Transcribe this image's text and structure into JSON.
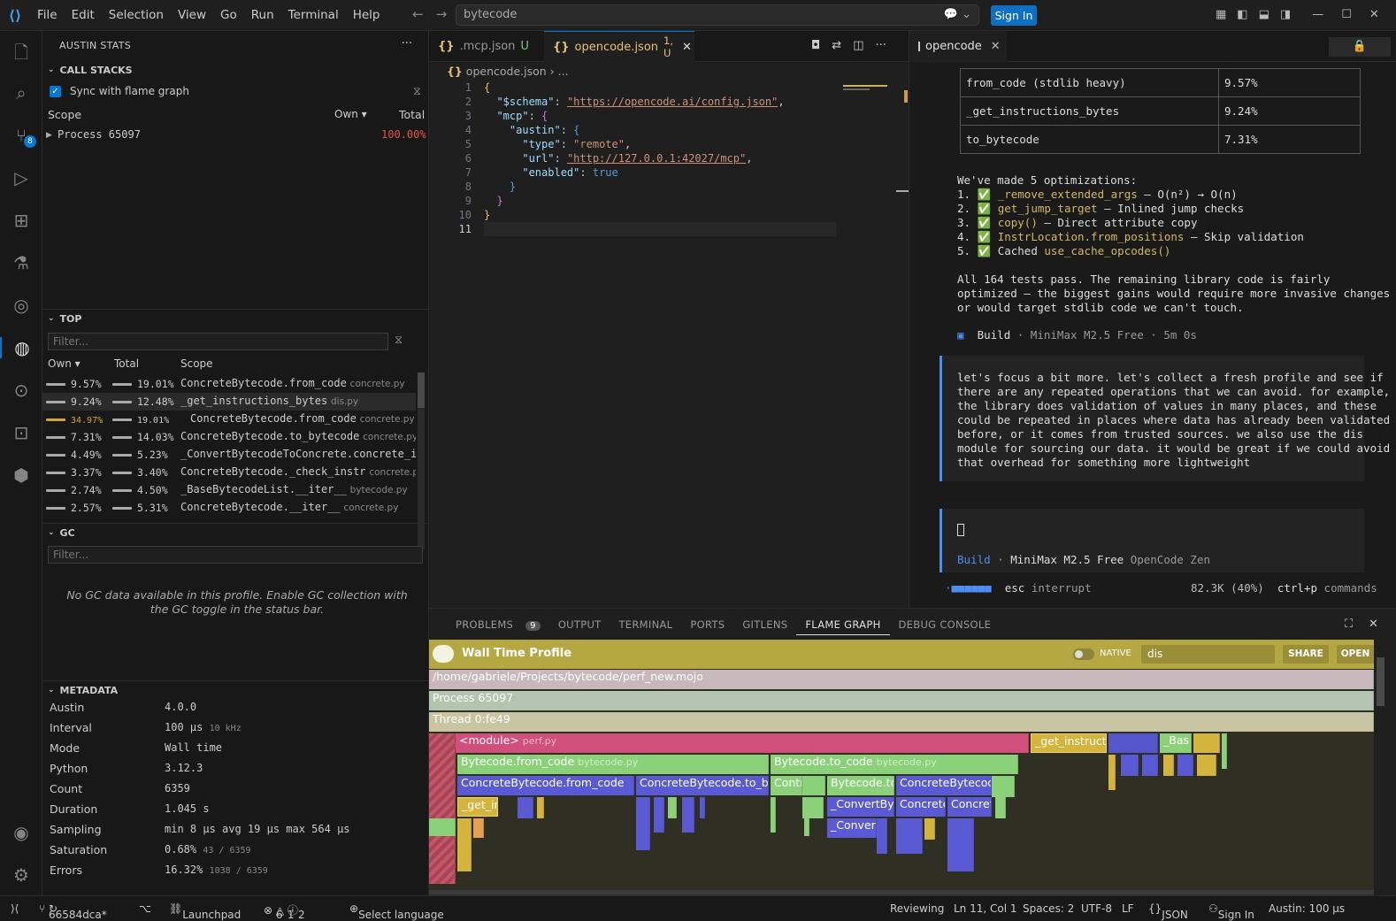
{
  "menu": [
    "File",
    "Edit",
    "Selection",
    "View",
    "Go",
    "Run",
    "Terminal",
    "Help"
  ],
  "search": {
    "value": "bytecode"
  },
  "signin_label": "Sign In",
  "activity": {
    "scm_badge": "8"
  },
  "sidebar": {
    "title": "AUSTIN STATS",
    "callstacks": {
      "header": "CALL STACKS",
      "sync_label": "Sync with flame graph",
      "cols": {
        "scope": "Scope",
        "own": "Own ▾",
        "total": "Total"
      },
      "process": "Process 65097",
      "process_total": "100.00%"
    },
    "top": {
      "header": "TOP",
      "filter_placeholder": "Filter...",
      "cols": {
        "own": "Own ▾",
        "total": "Total",
        "scope": "Scope"
      },
      "rows": [
        {
          "own": "9.57%",
          "total": "19.01%",
          "scope": "ConcreteBytecode.from_code",
          "file": "concrete.py"
        },
        {
          "own": "9.24%",
          "total": "12.48%",
          "scope": "_get_instructions_bytes",
          "file": "dis.py"
        },
        {
          "own": "34.97%",
          "total": "19.01%",
          "scope": "ConcreteBytecode.from_code",
          "file": "concrete.py"
        },
        {
          "own": "7.31%",
          "total": "14.03%",
          "scope": "ConcreteBytecode.to_bytecode",
          "file": "concrete.py"
        },
        {
          "own": "4.49%",
          "total": "5.23%",
          "scope": "_ConvertBytecodeToConcrete.concrete_inst",
          "file": ""
        },
        {
          "own": "3.37%",
          "total": "3.40%",
          "scope": "ConcreteBytecode._check_instr",
          "file": "concrete.py"
        },
        {
          "own": "2.74%",
          "total": "4.50%",
          "scope": "_BaseBytecodeList.__iter__",
          "file": "bytecode.py"
        },
        {
          "own": "2.57%",
          "total": "5.31%",
          "scope": "ConcreteBytecode.__iter__",
          "file": "concrete.py"
        }
      ]
    },
    "gc": {
      "header": "GC",
      "filter_placeholder": "Filter...",
      "empty": "No GC data available in this profile. Enable GC collection with the GC toggle in the status bar."
    },
    "metadata": {
      "header": "METADATA",
      "rows": [
        {
          "k": "Austin",
          "v": "4.0.0",
          "s": ""
        },
        {
          "k": "Interval",
          "v": "100 μs",
          "s": "10 kHz"
        },
        {
          "k": "Mode",
          "v": "Wall time",
          "s": ""
        },
        {
          "k": "Python",
          "v": "3.12.3",
          "s": ""
        },
        {
          "k": "Count",
          "v": "6359",
          "s": ""
        },
        {
          "k": "Duration",
          "v": "1.045 s",
          "s": ""
        },
        {
          "k": "Sampling",
          "v": "min 8 μs  avg 19 μs  max 564 μs",
          "s": ""
        },
        {
          "k": "Saturation",
          "v": "0.68%",
          "s": "43 / 6359"
        },
        {
          "k": "Errors",
          "v": "16.32%",
          "s": "1038 / 6359"
        }
      ]
    }
  },
  "editor": {
    "tabs": [
      {
        "label": ".mcp.json",
        "status": "U"
      },
      {
        "label": "opencode.json",
        "status": "1, U"
      }
    ],
    "breadcrumb": "opencode.json",
    "breadcrumb_more": "...",
    "lines": [
      "1",
      "2",
      "3",
      "4",
      "5",
      "6",
      "7",
      "8",
      "9",
      "10",
      "11"
    ],
    "code": {
      "schema_key": "\"$schema\"",
      "schema_val": "\"https://opencode.ai/config.json\"",
      "mcp_key": "\"mcp\"",
      "austin_key": "\"austin\"",
      "type_key": "\"type\"",
      "type_val": "\"remote\"",
      "url_key": "\"url\"",
      "url_val": "\"http://127.0.0.1:42027/mcp\"",
      "enabled_key": "\"enabled\"",
      "enabled_val": "true"
    }
  },
  "terminal": {
    "tab": "opencode",
    "table": [
      {
        "name": "from_code (stdlib heavy)",
        "pct": "9.57%"
      },
      {
        "name": "_get_instructions_bytes",
        "pct": "9.24%"
      },
      {
        "name": "to_bytecode",
        "pct": "7.31%"
      }
    ],
    "opt_header": "We've made 5 optimizations:",
    "opts": [
      {
        "n": "1.",
        "name": "_remove_extended_args",
        "desc": " – O(n²) → O(n)"
      },
      {
        "n": "2.",
        "name": "get_jump_target",
        "desc": " – Inlined jump checks"
      },
      {
        "n": "3.",
        "name": "copy()",
        "desc": " – Direct attribute copy"
      },
      {
        "n": "4.",
        "name": "InstrLocation.from_positions",
        "desc": " – Skip validation"
      },
      {
        "n": "5.",
        "name": "use_cache_opcodes()",
        "desc": "Cached "
      }
    ],
    "summary": [
      "All 164 tests pass. The remaining library code is fairly",
      "optimized – the biggest gains would require more invasive changes",
      "or would target stdlib code we can't touch."
    ],
    "build_line": {
      "label": "Build",
      "rest": " · MiniMax M2.5 Free · 5m 0s"
    },
    "prompt": [
      "let's focus a bit more. let's collect a fresh profile and see if",
      "there are any repeated operations that we can avoid. for example,",
      "the library does validation of values in many places, and these",
      "could be repeated in places where data has already been validated",
      "before, or it comes from trusted sources. we also use the dis",
      "module for sourcing our data. it would be great if we could avoid",
      "that overhead for something more lightweight"
    ],
    "footer": {
      "build": "Build",
      "model": "MiniMax M2.5 Free",
      "zen": "OpenCode Zen"
    },
    "status": {
      "esc": "esc",
      "interrupt": "interrupt",
      "tokens": "82.3K (40%)",
      "cmd": "ctrl+p",
      "commands": "commands"
    }
  },
  "panel": {
    "tabs": [
      "PROBLEMS",
      "OUTPUT",
      "TERMINAL",
      "PORTS",
      "GITLENS",
      "FLAME GRAPH",
      "DEBUG CONSOLE"
    ],
    "problems_badge": "9"
  },
  "flame": {
    "title": "Wall Time Profile",
    "native_label": "NATIVE",
    "search_value": "dis",
    "share": "SHARE",
    "open": "OPEN",
    "path": "/home/gabriele/Projects/bytecode/perf_new.mojo",
    "process": "Process 65097",
    "thread": "Thread 0:fe49",
    "module": "<module>",
    "module_file": "perf.py",
    "get_instr": "_get_instructi",
    "bas": "_Bas",
    "bfc": "Bytecode.from_code",
    "bfc_file": "bytecode.py",
    "btc": "Bytecode.to_code",
    "btc_file": "bytecode.py",
    "cbfc": "ConcreteBytecode.from_code",
    "cbtb": "ConcreteBytecode.to_by",
    "contr": "Contr",
    "bto": "Bytecode.to",
    "cbc": "ConcreteBytecod",
    "getin": "_get_in",
    "convb": "_ConvertByt",
    "concr": "Concrete",
    "concr2": "Concret",
    "conv2": "_Convert"
  },
  "status": {
    "branch": "66584dca*",
    "launchpad": "Launchpad",
    "errors": "6",
    "warnings": "1",
    "info": "2",
    "lang": "Select language",
    "reviewing": "Reviewing",
    "pos": "Ln 11, Col 1",
    "spaces": "Spaces: 2",
    "enc": "UTF-8",
    "eol": "LF",
    "mode": "JSON",
    "signin": "Sign In",
    "austin": "Austin: 100 μs"
  }
}
